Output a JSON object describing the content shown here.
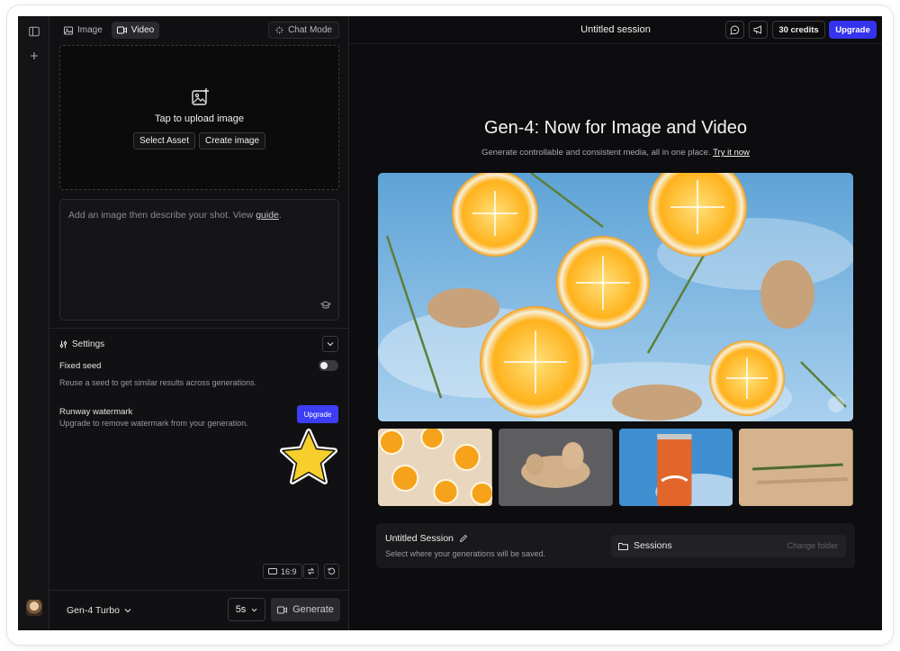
{
  "rail": {
    "toggle_icon": "sidebar-toggle-icon",
    "new_icon": "plus-icon"
  },
  "panel": {
    "tabs": [
      {
        "label": "Image",
        "icon": "image-icon",
        "active": false
      },
      {
        "label": "Video",
        "icon": "video-icon",
        "active": true
      }
    ],
    "chat_mode_label": "Chat Mode",
    "upload": {
      "title": "Tap to upload image",
      "select_asset_label": "Select Asset",
      "create_image_label": "Create image"
    },
    "prompt": {
      "placeholder_before": "Add an image then describe your shot. View ",
      "placeholder_link": "guide",
      "placeholder_after": "."
    },
    "settings": {
      "label": "Settings",
      "fixed_seed": {
        "title": "Fixed seed",
        "description": "Reuse a seed to get similar results across generations.",
        "enabled": false
      },
      "watermark": {
        "title": "Runway watermark",
        "description": "Upgrade to remove watermark from your generation.",
        "button_label": "Upgrade"
      }
    },
    "aspect_ratio": "16:9",
    "model_label": "Gen-4 Turbo",
    "duration_label": "5s",
    "generate_label": "Generate"
  },
  "main": {
    "session_title": "Untitled session",
    "credits_label": "30 credits",
    "upgrade_label": "Upgrade",
    "headline": "Gen-4: Now for Image and Video",
    "subline": "Generate controllable and consistent media, all in one place.",
    "subline_link": "Try it now",
    "session_card": {
      "title": "Untitled Session",
      "subtitle": "Select where your generations will be saved.",
      "sessions_label": "Sessions",
      "change_folder_label": "Change folder"
    }
  },
  "colors": {
    "accent": "#3434ee",
    "background": "#0d0d0f",
    "panel": "#111113"
  }
}
